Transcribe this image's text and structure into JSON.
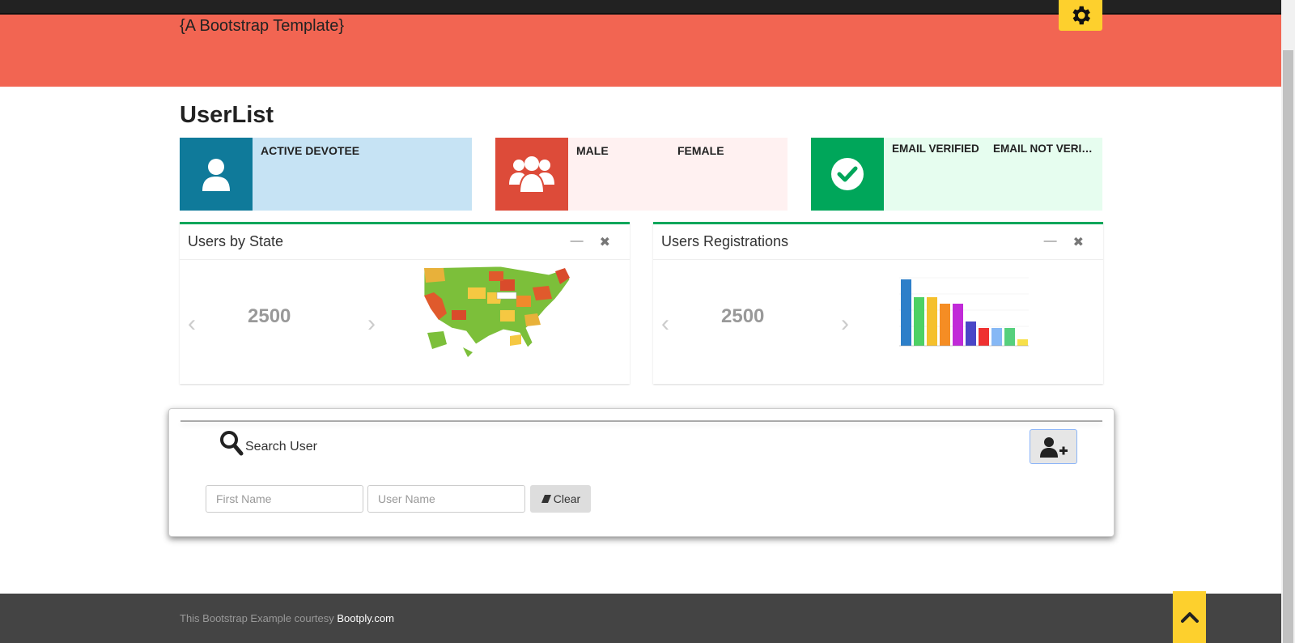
{
  "header": {
    "brand": "{A Bootstrap Template}"
  },
  "page": {
    "title": "UserList"
  },
  "stats": [
    {
      "icon": "user-icon",
      "color": "#0f7a9a",
      "bg": "#c6e3f4",
      "labels": [
        "ACTIVE DEVOTEE"
      ]
    },
    {
      "icon": "users-group-icon",
      "color": "#dd4b39",
      "bg": "#fff1f1",
      "labels": [
        "MALE",
        "FEMALE"
      ]
    },
    {
      "icon": "check-circle-icon",
      "color": "#00a65a",
      "bg": "#e6fdef",
      "labels": [
        "EMAIL VERIFIED",
        "EMAIL NOT VERIFIED"
      ]
    }
  ],
  "panels": [
    {
      "title": "Users by State",
      "value": "2500",
      "image": "us-states-map"
    },
    {
      "title": "Users Registrations",
      "value": "2500",
      "image": "bar-chart-thumbnail"
    }
  ],
  "search": {
    "label": "Search User",
    "first_name_placeholder": "First Name",
    "user_name_placeholder": "User Name",
    "clear_label": "Clear"
  },
  "footer": {
    "text": "This Bootstrap Example courtesy ",
    "link": "Bootply.com"
  },
  "colors": {
    "header": "#f26552",
    "accent": "#fdd02d",
    "panel_border": "#00a65a"
  }
}
